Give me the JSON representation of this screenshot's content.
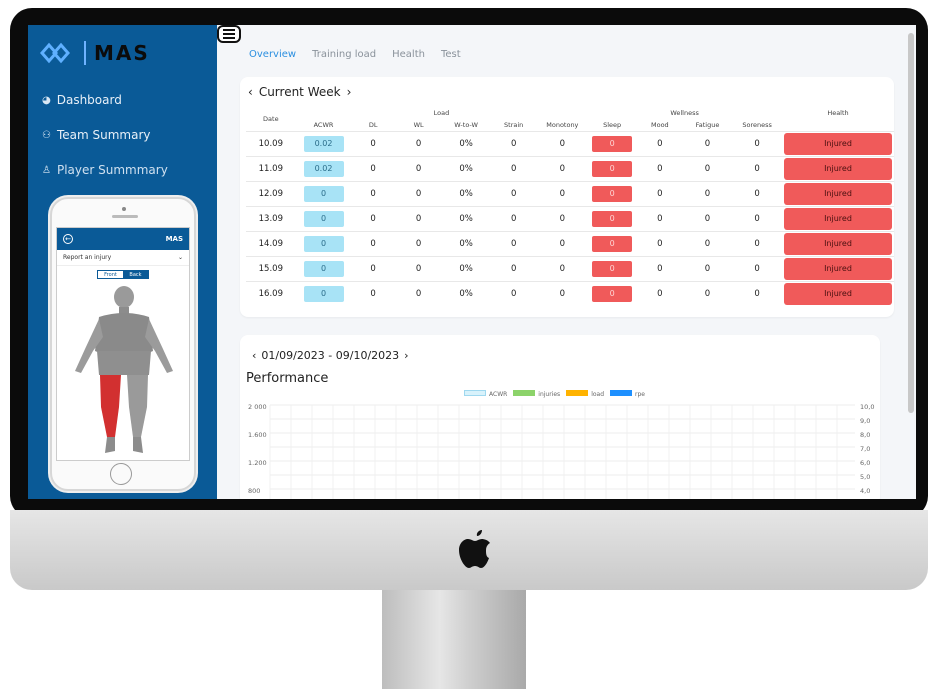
{
  "app": {
    "logo_text": "MAS",
    "nav": [
      {
        "icon": "dashboard-icon",
        "label": "Dashboard"
      },
      {
        "icon": "team-icon",
        "label": "Team Summary"
      },
      {
        "icon": "user-icon",
        "label": "Player Summmary"
      }
    ]
  },
  "phone": {
    "header_logo": "MAS",
    "report_label": "Report an injury",
    "toggle": [
      "Front",
      "Back"
    ]
  },
  "tabs": [
    "Overview",
    "Training load",
    "Health",
    "Test"
  ],
  "week": {
    "title": "Current Week",
    "group_headers": {
      "load": "Load",
      "wellness": "Wellness",
      "health": "Health"
    },
    "columns": [
      "Date",
      "ACWR",
      "DL",
      "WL",
      "W-to-W",
      "Strain",
      "Monotony",
      "Sleep",
      "Mood",
      "Fatigue",
      "Soreness"
    ],
    "rows": [
      {
        "date": "10.09",
        "acwr": "0.02",
        "dl": "0",
        "wl": "0",
        "wtow": "0%",
        "strain": "0",
        "monotony": "0",
        "sleep": "0",
        "mood": "0",
        "fatigue": "0",
        "soreness": "0",
        "health": "Injured"
      },
      {
        "date": "11.09",
        "acwr": "0.02",
        "dl": "0",
        "wl": "0",
        "wtow": "0%",
        "strain": "0",
        "monotony": "0",
        "sleep": "0",
        "mood": "0",
        "fatigue": "0",
        "soreness": "0",
        "health": "Injured"
      },
      {
        "date": "12.09",
        "acwr": "0",
        "dl": "0",
        "wl": "0",
        "wtow": "0%",
        "strain": "0",
        "monotony": "0",
        "sleep": "0",
        "mood": "0",
        "fatigue": "0",
        "soreness": "0",
        "health": "Injured"
      },
      {
        "date": "13.09",
        "acwr": "0",
        "dl": "0",
        "wl": "0",
        "wtow": "0%",
        "strain": "0",
        "monotony": "0",
        "sleep": "0",
        "mood": "0",
        "fatigue": "0",
        "soreness": "0",
        "health": "Injured"
      },
      {
        "date": "14.09",
        "acwr": "0",
        "dl": "0",
        "wl": "0",
        "wtow": "0%",
        "strain": "0",
        "monotony": "0",
        "sleep": "0",
        "mood": "0",
        "fatigue": "0",
        "soreness": "0",
        "health": "Injured"
      },
      {
        "date": "15.09",
        "acwr": "0",
        "dl": "0",
        "wl": "0",
        "wtow": "0%",
        "strain": "0",
        "monotony": "0",
        "sleep": "0",
        "mood": "0",
        "fatigue": "0",
        "soreness": "0",
        "health": "Injured"
      },
      {
        "date": "16.09",
        "acwr": "0",
        "dl": "0",
        "wl": "0",
        "wtow": "0%",
        "strain": "0",
        "monotony": "0",
        "sleep": "0",
        "mood": "0",
        "fatigue": "0",
        "soreness": "0",
        "health": "Injured"
      }
    ]
  },
  "performance": {
    "range": "01/09/2023 - 09/10/2023",
    "title": "Performance",
    "legend": [
      {
        "name": "ACWR",
        "color": "#d8f2fb"
      },
      {
        "name": "injuries",
        "color": "#8cd36a"
      },
      {
        "name": "load",
        "color": "#ffb300"
      },
      {
        "name": "rpe",
        "color": "#1e90ff"
      }
    ],
    "y_left": [
      "2 000",
      "1.600",
      "1.200",
      "800"
    ],
    "y_right": [
      "10,0",
      "9,0",
      "8,0",
      "7,0",
      "6,0",
      "5,0",
      "4,0"
    ]
  },
  "colors": {
    "sidebar": "#0a5a97",
    "accent": "#2b8fe0",
    "injured": "#f05a5a",
    "acwr": "#a8e3f6"
  }
}
